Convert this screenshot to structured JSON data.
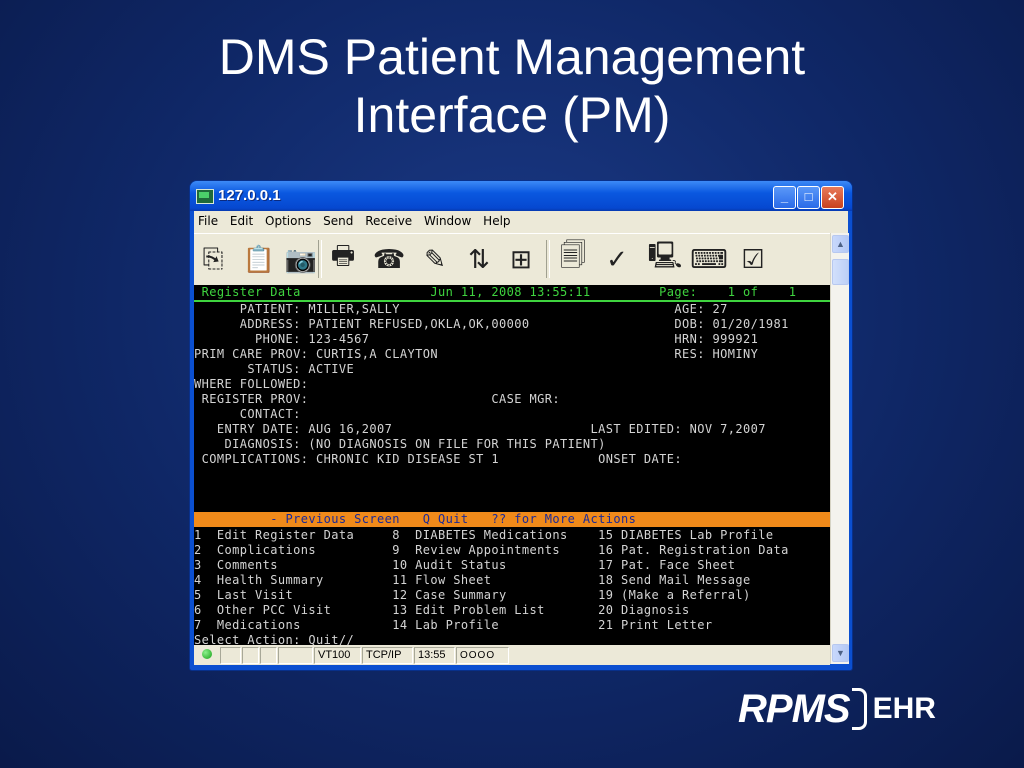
{
  "slide": {
    "title_line1": "DMS Patient Management",
    "title_line2": "Interface  (PM)"
  },
  "window": {
    "title": "127.0.0.1",
    "minimize": "_",
    "maximize": "□",
    "close": "✕"
  },
  "menu": [
    "File",
    "Edit",
    "Options",
    "Send",
    "Receive",
    "Window",
    "Help"
  ],
  "toolbar_icons": [
    "copy-icon",
    "paste-icon",
    "camera-icon",
    "print-icon",
    "phone-icon",
    "pen-icon",
    "transfer-icon",
    "connect-icon",
    "documents-icon",
    "spellcheck-icon",
    "computer-icon",
    "keyboard-icon",
    "check-icon"
  ],
  "terminal": {
    "header": " Register Data                 Jun 11, 2008 13:55:11         Page:    1 of    1",
    "lines": [
      "      PATIENT: MILLER,SALLY                                    AGE: 27",
      "      ADDRESS: PATIENT REFUSED,OKLA,OK,00000                   DOB: 01/20/1981",
      "        PHONE: 123-4567                                        HRN: 999921",
      "PRIM CARE PROV: CURTIS,A CLAYTON                               RES: HOMINY",
      "       STATUS: ACTIVE",
      "WHERE FOLLOWED:",
      " REGISTER PROV:                        CASE MGR:",
      "      CONTACT:",
      "   ENTRY DATE: AUG 16,2007                          LAST EDITED: NOV 7,2007",
      "    DIAGNOSIS: (NO DIAGNOSIS ON FILE FOR THIS PATIENT)",
      " COMPLICATIONS: CHRONIC KID DISEASE ST 1             ONSET DATE:"
    ],
    "action_bar": "          - Previous Screen   Q Quit   ?? for More Actions",
    "actions": [
      "1  Edit Register Data     8  DIABETES Medications    15 DIABETES Lab Profile",
      "2  Complications          9  Review Appointments     16 Pat. Registration Data",
      "3  Comments               10 Audit Status            17 Pat. Face Sheet",
      "4  Health Summary         11 Flow Sheet              18 Send Mail Message",
      "5  Last Visit             12 Case Summary            19 (Make a Referral)",
      "6  Other PCC Visit        13 Edit Problem List       20 Diagnosis",
      "7  Medications            14 Lab Profile             21 Print Letter"
    ],
    "prompt": "Select Action: Quit//"
  },
  "statusbar": {
    "emulation": "VT100",
    "protocol": "TCP/IP",
    "time": "13:55",
    "indicators": "OOOO"
  },
  "logo": {
    "rpms": "RPMS",
    "ehr": "EHR"
  },
  "colors": {
    "terminal_bg": "#000000",
    "terminal_text": "#d4d4d4",
    "header_green": "#3fd43f",
    "action_bar_bg": "#f08a1a",
    "action_bar_text": "#1a2a9a",
    "slide_bg": "#0f2766"
  }
}
